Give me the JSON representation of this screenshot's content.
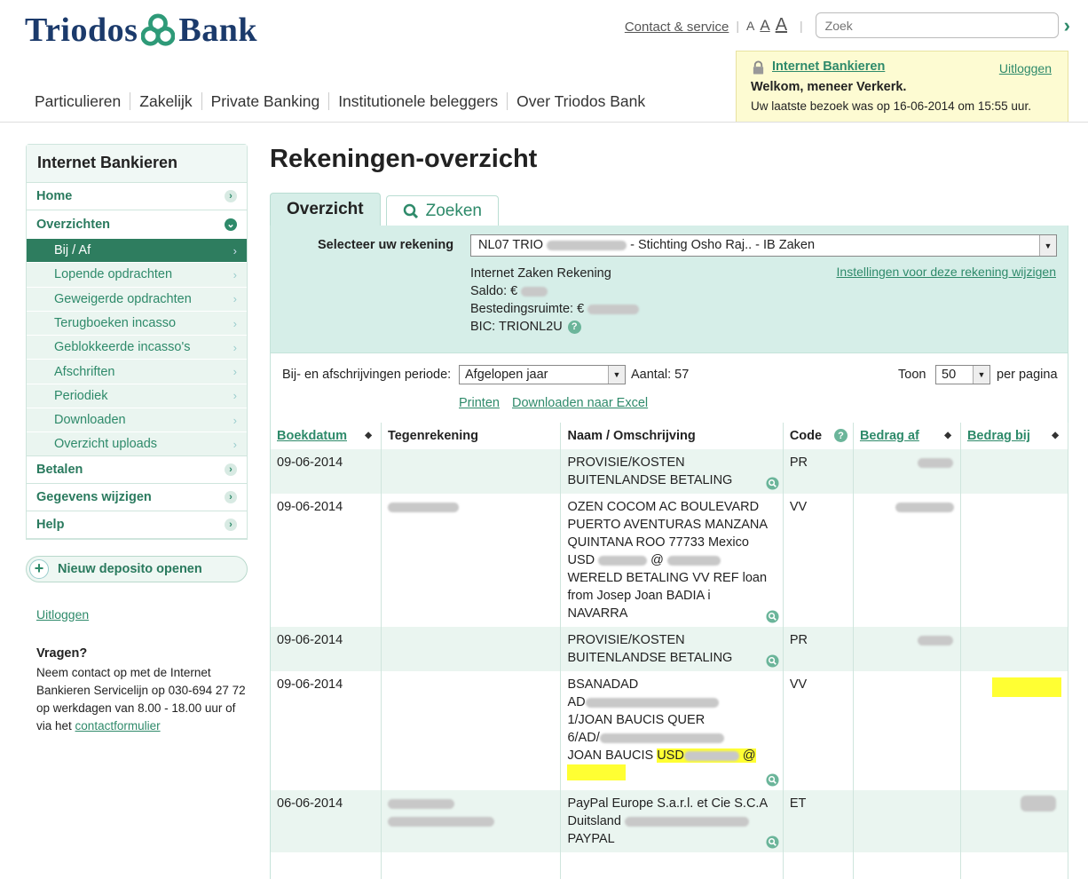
{
  "brand": {
    "name_left": "Triodos",
    "name_right": "Bank"
  },
  "topbar": {
    "contact": "Contact & service",
    "font_sizes": [
      "A",
      "A",
      "A"
    ],
    "search_placeholder": "Zoek"
  },
  "mainnav": [
    "Particulieren",
    "Zakelijk",
    "Private Banking",
    "Institutionele beleggers",
    "Over Triodos Bank"
  ],
  "welcome": {
    "title": "Internet Bankieren",
    "logout": "Uitloggen",
    "greeting": "Welkom, meneer Verkerk.",
    "last_visit": "Uw laatste bezoek was op 16-06-2014 om 15:55 uur."
  },
  "sidebar": {
    "header": "Internet Bankieren",
    "top_items": [
      "Home",
      "Overzichten",
      "Betalen",
      "Gegevens wijzigen",
      "Help"
    ],
    "sub_items": [
      "Bij / Af",
      "Lopende opdrachten",
      "Geweigerde opdrachten",
      "Terugboeken incasso",
      "Geblokkeerde incasso's",
      "Afschriften",
      "Periodiek",
      "Downloaden",
      "Overzicht uploads"
    ],
    "deposit": "Nieuw deposito openen",
    "logout": "Uitloggen",
    "questions_title": "Vragen?",
    "questions_text": "Neem contact op met de Internet Bankieren Servicelijn op 030-694 27 72 op werkdagen van 8.00 - 18.00 uur of",
    "questions_via": "via het",
    "questions_link": "contactformulier"
  },
  "main": {
    "title": "Rekeningen-overzicht",
    "tabs": [
      "Overzicht",
      "Zoeken"
    ],
    "select_label": "Selecteer uw rekening",
    "account_prefix": "NL07 TRIO",
    "account_suffix": "- Stichting Osho Raj.. - IB Zaken",
    "account_type": "Internet Zaken Rekening",
    "saldo": "Saldo: €",
    "bestedingsruimte": "Bestedingsruimte: €",
    "bic": "BIC: TRIONL2U",
    "settings_link": "Instellingen voor deze rekening wijzigen",
    "period_label": "Bij- en afschrijvingen periode:",
    "period_value": "Afgelopen jaar",
    "count": "Aantal: 57",
    "show_label": "Toon",
    "per_page_value": "50",
    "per_page_label": "per pagina",
    "print": "Printen",
    "excel": "Downloaden naar Excel"
  },
  "table": {
    "headers": [
      "Boekdatum",
      "Tegenrekening",
      "Naam / Omschrijving",
      "Code",
      "Bedrag af",
      "Bedrag bij"
    ],
    "rows": [
      {
        "date": "09-06-2014",
        "desc": [
          "PROVISIE/KOSTEN",
          "BUITENLANDSE BETALING"
        ],
        "code": "PR"
      },
      {
        "date": "09-06-2014",
        "desc": [
          "OZEN COCOM AC BOULEVARD",
          "PUERTO AVENTURAS MANZANA",
          "QUINTANA ROO 77733 Mexico",
          "USD",
          "WERELD BETALING VV REF loan",
          "from Josep Joan BADIA i",
          "NAVARRA"
        ],
        "code": "VV"
      },
      {
        "date": "09-06-2014",
        "desc": [
          "PROVISIE/KOSTEN",
          "BUITENLANDSE BETALING"
        ],
        "code": "PR"
      },
      {
        "date": "09-06-2014",
        "desc": [
          "BSANADAD",
          "AD",
          "1/JOAN BAUCIS QUER",
          "6/AD/",
          "JOAN BAUCIS",
          "USD"
        ],
        "code": "VV"
      },
      {
        "date": "06-06-2014",
        "desc": [
          "PayPal Europe S.a.r.l. et Cie S.C.A",
          "Duitsland",
          "PAYPAL"
        ],
        "code": "ET"
      }
    ]
  }
}
